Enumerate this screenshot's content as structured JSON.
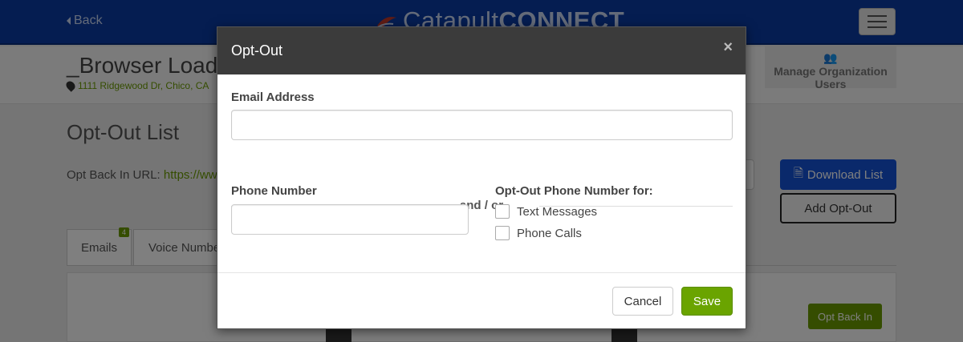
{
  "background": {
    "back_label": "Back",
    "brand_part1": "Catapult",
    "brand_part2": "CONNECT",
    "org_title": "_Browser Load",
    "org_address": "1111 Ridgewood Dr, Chico, CA",
    "manage_users_label": "Manage Organization Users",
    "list_title": "Opt-Out List",
    "optback_url_label": "Opt Back In URL:",
    "optback_url_value": "https://www.",
    "download_list_label": "Download List",
    "add_optout_label": "Add Opt-Out",
    "tabs": [
      {
        "label": "Emails",
        "badge": "4"
      },
      {
        "label": "Voice Numbers"
      }
    ],
    "opt_back_in_label": "Opt Back In"
  },
  "modal": {
    "title": "Opt-Out",
    "close_glyph": "×",
    "email_label": "Email Address",
    "email_value": "",
    "separator": "and / or",
    "phone_label": "Phone Number",
    "phone_value": "",
    "optout_for_label": "Opt-Out Phone Number for:",
    "options": [
      {
        "label": "Text Messages",
        "checked": false
      },
      {
        "label": "Phone Calls",
        "checked": false
      }
    ],
    "cancel_label": "Cancel",
    "save_label": "Save"
  },
  "colors": {
    "topbar": "#0b3aa3",
    "accent_green": "#6aa400",
    "modal_header": "#3b3b3b",
    "download_blue": "#1553d6"
  }
}
